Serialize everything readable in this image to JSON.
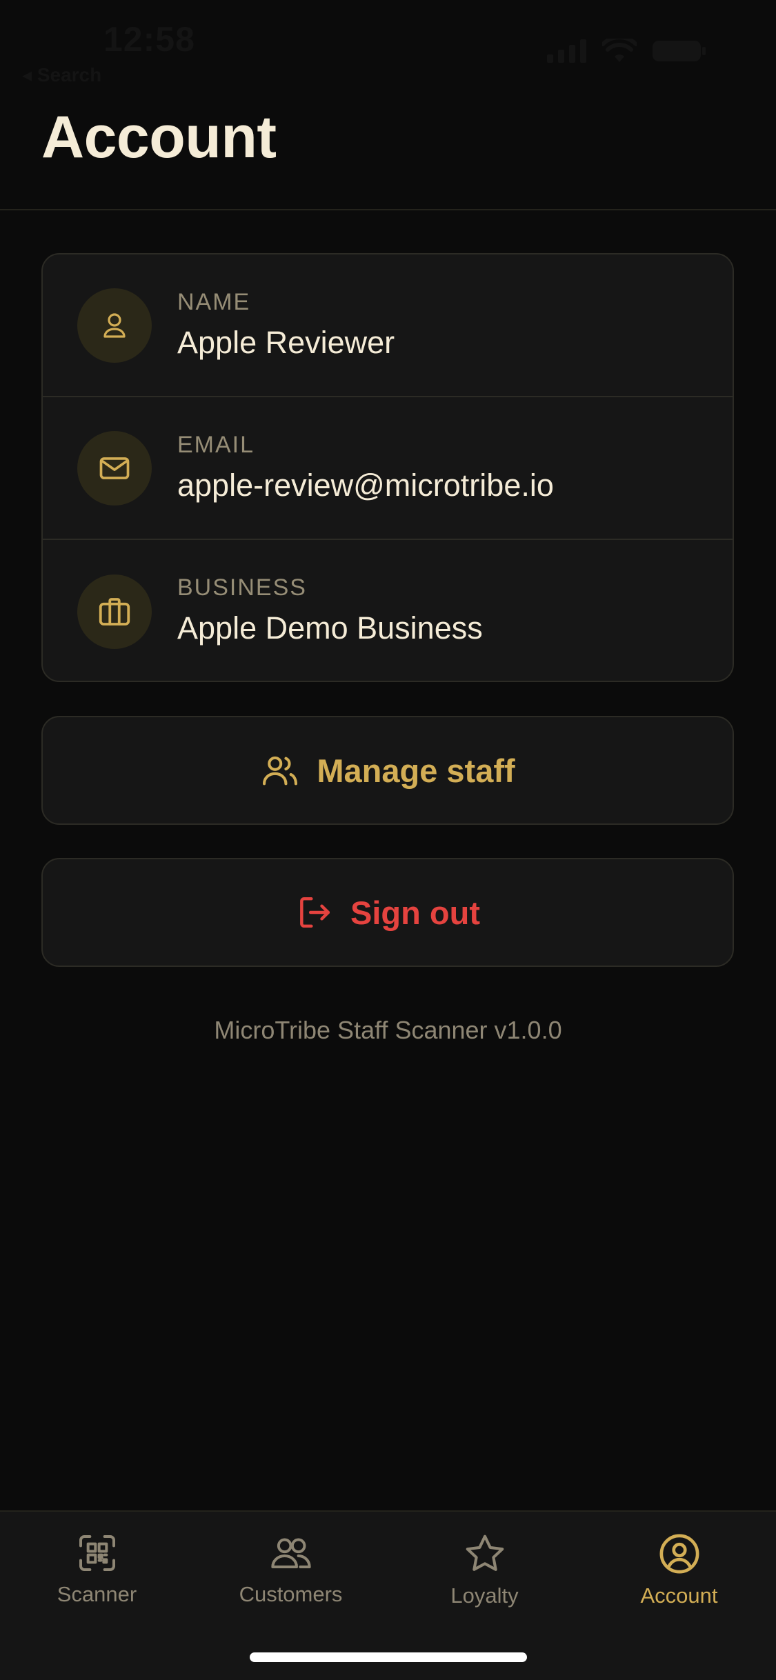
{
  "status_bar": {
    "time": "12:58",
    "back_label": "◂ Search"
  },
  "page": {
    "title": "Account"
  },
  "profile": {
    "rows": [
      {
        "label": "NAME",
        "value": "Apple Reviewer",
        "icon": "user-icon"
      },
      {
        "label": "EMAIL",
        "value": "apple-review@microtribe.io",
        "icon": "mail-icon"
      },
      {
        "label": "BUSINESS",
        "value": "Apple Demo Business",
        "icon": "briefcase-icon"
      }
    ]
  },
  "actions": {
    "manage_staff": "Manage staff",
    "sign_out": "Sign out"
  },
  "version": "MicroTribe Staff Scanner v1.0.0",
  "tabs": [
    {
      "label": "Scanner",
      "icon": "qr-scan-icon"
    },
    {
      "label": "Customers",
      "icon": "customers-icon"
    },
    {
      "label": "Loyalty",
      "icon": "star-icon"
    },
    {
      "label": "Account",
      "icon": "account-icon",
      "active": true
    }
  ],
  "colors": {
    "background": "#0b0b0b",
    "accent_gold": "#d3ae55",
    "danger_red": "#e5433f",
    "text_primary": "#f5ecd7",
    "text_muted": "#968d76"
  }
}
